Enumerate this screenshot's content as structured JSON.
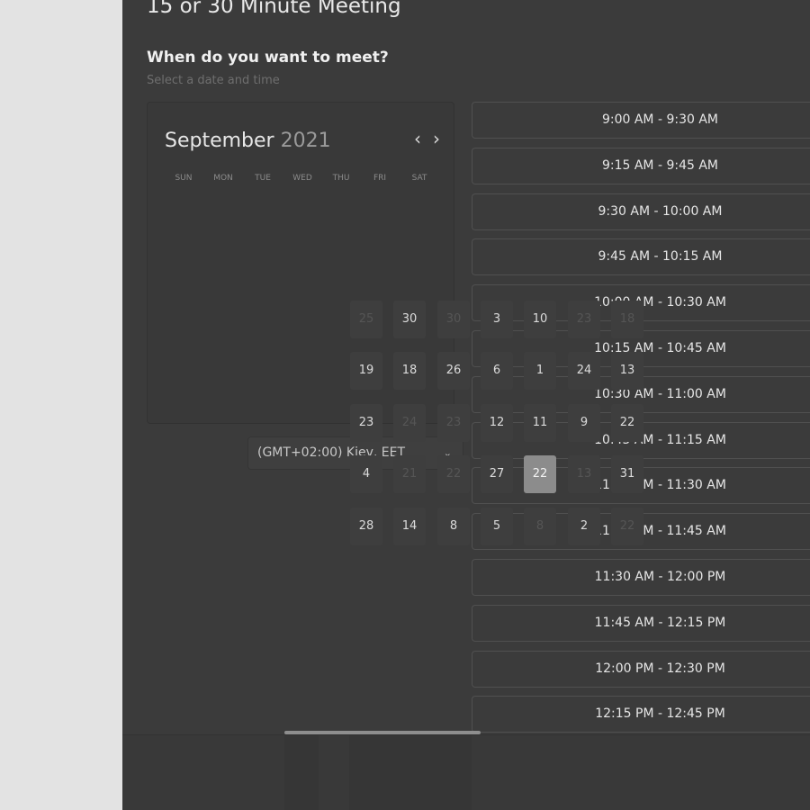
{
  "page_title": "15 or 30 Minute Meeting",
  "section": {
    "heading": "When do you want to meet?",
    "subheading": "Select a date and time"
  },
  "calendar": {
    "month": "September",
    "year": "2021",
    "prev_icon": "‹",
    "next_icon": "›",
    "weekdays": [
      "SUN",
      "MON",
      "TUE",
      "WED",
      "THU",
      "FRI",
      "SAT"
    ],
    "days": [
      {
        "label": "25",
        "muted": true
      },
      {
        "label": "30",
        "muted": false
      },
      {
        "label": "30",
        "muted": true
      },
      {
        "label": "3",
        "muted": false
      },
      {
        "label": "10",
        "muted": false
      },
      {
        "label": "23",
        "muted": true
      },
      {
        "label": "18",
        "muted": true
      },
      {
        "label": "19",
        "muted": false
      },
      {
        "label": "18",
        "muted": false
      },
      {
        "label": "26",
        "muted": false
      },
      {
        "label": "6",
        "muted": false
      },
      {
        "label": "1",
        "muted": false
      },
      {
        "label": "24",
        "muted": false
      },
      {
        "label": "13",
        "muted": false
      },
      {
        "label": "23",
        "muted": false
      },
      {
        "label": "24",
        "muted": true
      },
      {
        "label": "23",
        "muted": true
      },
      {
        "label": "12",
        "muted": false
      },
      {
        "label": "11",
        "muted": false
      },
      {
        "label": "9",
        "muted": false
      },
      {
        "label": "22",
        "muted": false
      },
      {
        "label": "4",
        "muted": false
      },
      {
        "label": "21",
        "muted": true
      },
      {
        "label": "22",
        "muted": true
      },
      {
        "label": "27",
        "muted": false
      },
      {
        "label": "22",
        "muted": false,
        "selected": true
      },
      {
        "label": "13",
        "muted": true
      },
      {
        "label": "31",
        "muted": false
      },
      {
        "label": "28",
        "muted": false
      },
      {
        "label": "14",
        "muted": false
      },
      {
        "label": "8",
        "muted": false
      },
      {
        "label": "5",
        "muted": false
      },
      {
        "label": "8",
        "muted": true
      },
      {
        "label": "2",
        "muted": false
      },
      {
        "label": "22",
        "muted": true
      }
    ]
  },
  "timezone": {
    "label": "(GMT+02:00) Kiev, EET",
    "chevron_icon": "chevron-down-icon"
  },
  "time_slots": [
    "9:00 AM - 9:30 AM",
    "9:15 AM - 9:45 AM",
    "9:30 AM - 10:00 AM",
    "9:45 AM - 10:15 AM",
    "10:00 AM - 10:30 AM",
    "10:15 AM - 10:45 AM",
    "10:30 AM - 11:00 AM",
    "10:45 AM - 11:15 AM",
    "11:00 AM - 11:30 AM",
    "11:15 AM - 11:45 AM",
    "11:30 AM - 12:00 PM",
    "11:45 AM - 12:15 PM",
    "12:00 PM - 12:30 PM",
    "12:15 PM - 12:45 PM"
  ],
  "colors": {
    "panel_bg": "#3b3b3b",
    "page_bg": "#e3e3e3",
    "selected_day": "#8c8c8c",
    "slot_border": "#505050"
  }
}
